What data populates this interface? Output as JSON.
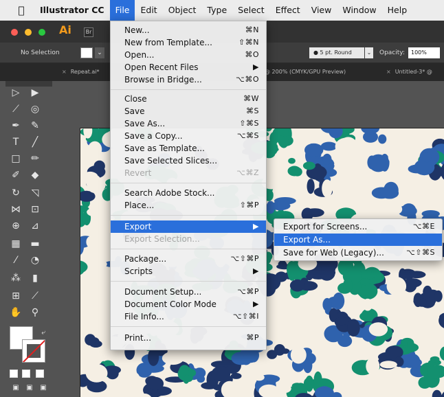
{
  "menubar": {
    "apple_icon": "apple-logo",
    "app": "Illustrator CC",
    "items": [
      "File",
      "Edit",
      "Object",
      "Type",
      "Select",
      "Effect",
      "View",
      "Window",
      "Help"
    ]
  },
  "app": {
    "logo": "Ai",
    "bridge": "Br"
  },
  "control_bar": {
    "selection": "No Selection",
    "stroke_profile": "5 pt. Round",
    "opacity_label": "Opacity:",
    "opacity_value": "100%"
  },
  "tabs": [
    {
      "label": "Repeat.ai*"
    },
    {
      "label": "@ 200% (CMYK/GPU Preview)"
    },
    {
      "label": "Untitled-3* @"
    }
  ],
  "file_menu": {
    "items": [
      {
        "label": "New...",
        "shortcut": "⌘N"
      },
      {
        "label": "New from Template...",
        "shortcut": "⇧⌘N"
      },
      {
        "label": "Open...",
        "shortcut": "⌘O"
      },
      {
        "label": "Open Recent Files",
        "shortcut": "▶"
      },
      {
        "label": "Browse in Bridge...",
        "shortcut": "⌥⌘O"
      },
      {
        "label": "Close",
        "shortcut": "⌘W"
      },
      {
        "label": "Save",
        "shortcut": "⌘S"
      },
      {
        "label": "Save As...",
        "shortcut": "⇧⌘S"
      },
      {
        "label": "Save a Copy...",
        "shortcut": "⌥⌘S"
      },
      {
        "label": "Save as Template...",
        "shortcut": ""
      },
      {
        "label": "Save Selected Slices...",
        "shortcut": ""
      },
      {
        "label": "Revert",
        "shortcut": "⌥⌘Z"
      },
      {
        "label": "Search Adobe Stock...",
        "shortcut": ""
      },
      {
        "label": "Place...",
        "shortcut": "⇧⌘P"
      },
      {
        "label": "Export",
        "shortcut": "▶"
      },
      {
        "label": "Export Selection...",
        "shortcut": ""
      },
      {
        "label": "Package...",
        "shortcut": "⌥⇧⌘P"
      },
      {
        "label": "Scripts",
        "shortcut": "▶"
      },
      {
        "label": "Document Setup...",
        "shortcut": "⌥⌘P"
      },
      {
        "label": "Document Color Mode",
        "shortcut": "▶"
      },
      {
        "label": "File Info...",
        "shortcut": "⌥⇧⌘I"
      },
      {
        "label": "Print...",
        "shortcut": "⌘P"
      }
    ]
  },
  "export_submenu": {
    "items": [
      {
        "label": "Export for Screens...",
        "shortcut": "⌥⌘E"
      },
      {
        "label": "Export As...",
        "shortcut": ""
      },
      {
        "label": "Save for Web (Legacy)...",
        "shortcut": "⌥⇧⌘S"
      }
    ]
  },
  "colors": {
    "menu_highlight": "#2a6fdb",
    "pattern_green": "#13906f",
    "pattern_blue": "#2f62ad",
    "pattern_navy": "#1f3566",
    "pattern_cream": "#f5efe4",
    "ai_orange": "#f29a1c"
  }
}
